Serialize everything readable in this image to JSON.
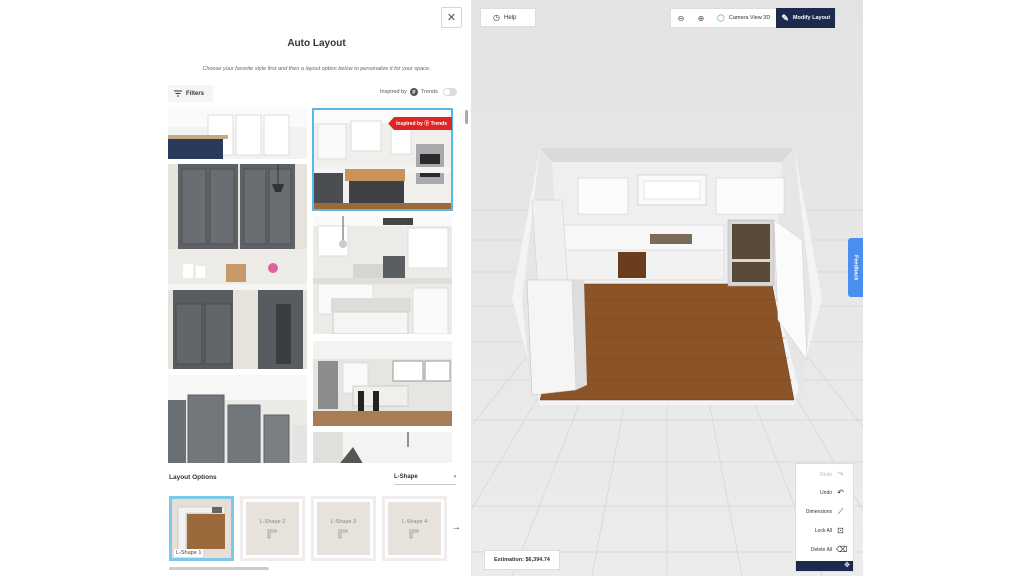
{
  "panel": {
    "title": "Auto Layout",
    "subtitle": "Choose your favorite style first and then a layout option below to personalize it for your space.",
    "close_icon": "✕",
    "filters_label": "Filters",
    "inspired_label": "Inspired by",
    "trends_label": "Trends",
    "badge_text": "Inspired by ⓟ Trends"
  },
  "layout_options": {
    "label": "Layout Options",
    "selected": "L-Shape",
    "thumbs": [
      {
        "label": "L-Shape 1"
      },
      {
        "label": "L-Shape 2"
      },
      {
        "label": "L-Shape 3"
      },
      {
        "label": "L-Shape 4"
      }
    ]
  },
  "toolbar": {
    "help_label": "Help",
    "camera_label": "Camera View 3D",
    "modify_label": "Modify Layout"
  },
  "feedback_label": "Feedback",
  "tools": {
    "redo": "Redo",
    "undo": "Undo",
    "dimensions": "Dimensions",
    "lock_all": "Lock All",
    "delete_all": "Delete All"
  },
  "estimation": "Estimation: $6,394.74",
  "colors": {
    "accent": "#1b2a4d",
    "selected_outline": "#5ab8e6",
    "badge_red": "#e02424",
    "feedback_blue": "#4a8ff0"
  }
}
